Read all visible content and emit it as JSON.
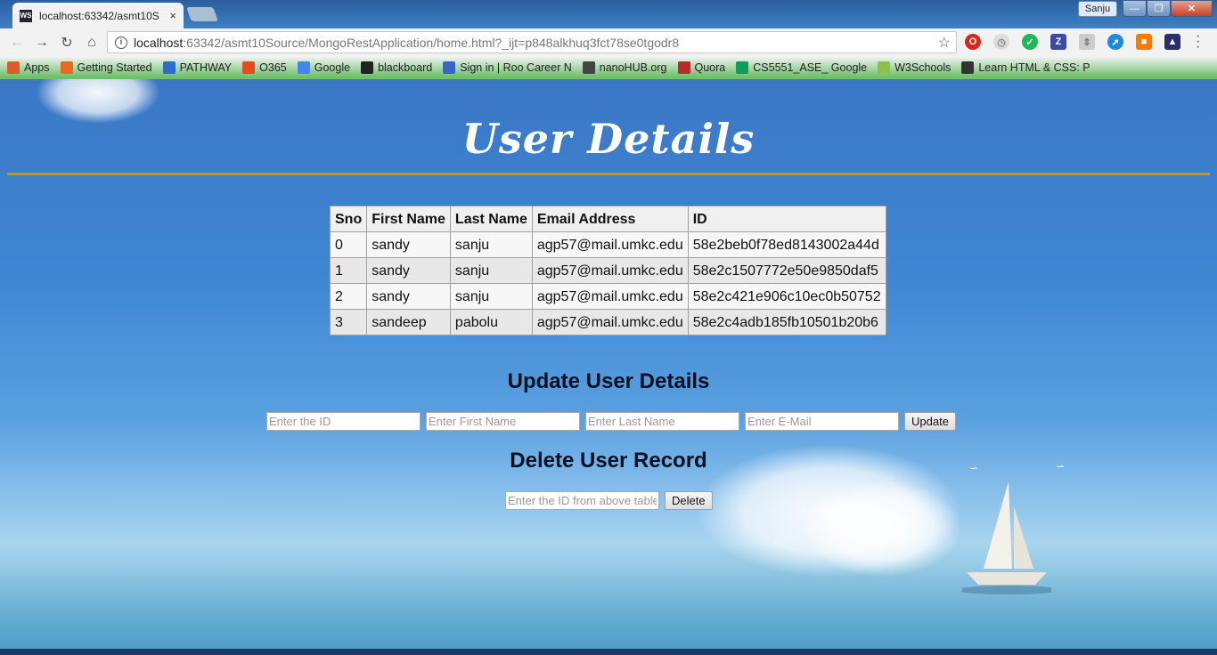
{
  "browser": {
    "tab_title": "localhost:63342/asmt10S",
    "tab_favicon": "WS",
    "tab_close": "×",
    "user_badge": "Sanju",
    "url_host": "localhost",
    "url_rest": ":63342/asmt10Source/MongoRestApplication/home.html?_ijt=p848alkhuq3fct78se0tgodr8",
    "bookmarks": [
      {
        "label": "Apps",
        "color": "#e05a2a"
      },
      {
        "label": "Getting Started",
        "color": "#e86a1e"
      },
      {
        "label": "PATHWAY",
        "color": "#2c6bd1"
      },
      {
        "label": "O365",
        "color": "#e8491d"
      },
      {
        "label": "Google",
        "color": "#4285f4"
      },
      {
        "label": "blackboard",
        "color": "#222222"
      },
      {
        "label": "Sign in | Roo Career N",
        "color": "#3b64c8"
      },
      {
        "label": "nanoHUB.org",
        "color": "#444444"
      },
      {
        "label": "Quora",
        "color": "#b92b27"
      },
      {
        "label": "CS5551_ASE_ Google",
        "color": "#0f9d58"
      },
      {
        "label": "W3Schools",
        "color": "#8bc34a"
      },
      {
        "label": "Learn HTML & CSS: P",
        "color": "#333333"
      }
    ]
  },
  "page": {
    "title": "User Details",
    "table": {
      "headers": [
        "Sno",
        "First Name",
        "Last Name",
        "Email Address",
        "ID"
      ],
      "rows": [
        [
          "0",
          "sandy",
          "sanju",
          "agp57@mail.umkc.edu",
          "58e2beb0f78ed8143002a44d"
        ],
        [
          "1",
          "sandy",
          "sanju",
          "agp57@mail.umkc.edu",
          "58e2c1507772e50e9850daf5"
        ],
        [
          "2",
          "sandy",
          "sanju",
          "agp57@mail.umkc.edu",
          "58e2c421e906c10ec0b50752"
        ],
        [
          "3",
          "sandeep",
          "pabolu",
          "agp57@mail.umkc.edu",
          "58e2c4adb185fb10501b20b6"
        ]
      ]
    },
    "update": {
      "title": "Update User Details",
      "id_placeholder": "Enter the ID",
      "first_placeholder": "Enter First Name",
      "last_placeholder": "Enter Last Name",
      "email_placeholder": "Enter E-Mail",
      "button": "Update"
    },
    "delete": {
      "title": "Delete User Record",
      "id_placeholder": "Enter the ID from above table",
      "button": "Delete"
    }
  }
}
